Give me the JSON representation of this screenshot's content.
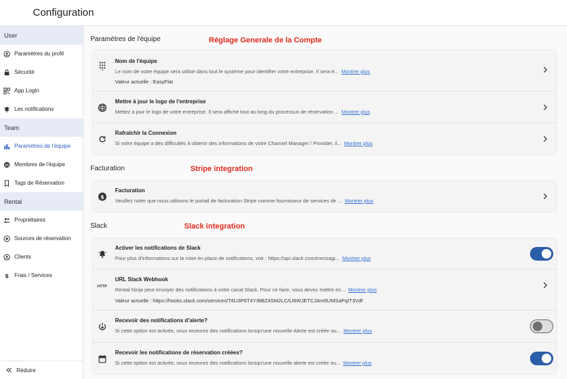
{
  "header": {
    "title": "Configuration"
  },
  "sidebar": {
    "sections": [
      {
        "label": "User",
        "items": [
          {
            "label": "Paramètres du profil",
            "icon": "account-circle-icon"
          },
          {
            "label": "Sécurité",
            "icon": "lock-icon"
          },
          {
            "label": "App Login",
            "icon": "qr-code-icon"
          },
          {
            "label": "Les notifications",
            "icon": "notification-bell-icon"
          }
        ]
      },
      {
        "label": "Team",
        "items": [
          {
            "label": "Paramètres de l'équipe",
            "icon": "bar-chart-icon",
            "active": true
          },
          {
            "label": "Membres de l'équipe",
            "icon": "team-circle-icon"
          },
          {
            "label": "Tags de Réservation",
            "icon": "bookmark-icon"
          }
        ]
      },
      {
        "label": "Rental",
        "items": [
          {
            "label": "Propriétaires",
            "icon": "people-icon"
          },
          {
            "label": "Sources de réservation",
            "icon": "source-icon"
          },
          {
            "label": "Clients",
            "icon": "client-icon"
          },
          {
            "label": "Frais / Services",
            "icon": "dollar-icon"
          }
        ]
      }
    ],
    "footer": {
      "label": "Réduire",
      "icon": "double-chevron-left-icon"
    }
  },
  "main": {
    "more_label": "Montrer plus",
    "team": {
      "title": "Paramètres de l'équipe",
      "annotation": "Réglage Generale de la Compte",
      "rows": [
        {
          "title": "Nom de l'équipe",
          "icon": "dialpad-icon",
          "desc": "Le nom de votre équipe sera utilisé dans tout le système pour identifier votre entreprise. Il sera é...",
          "value": "Valeur actuelle : EasyFlat"
        },
        {
          "title": "Mettre à jour le logo de l'entreprise",
          "icon": "globe-icon",
          "desc": "Mettez à jour le logo de votre entreprise. Il sera affiché tout au long du processus de réservation ..."
        },
        {
          "title": "Rafraîchir la Connexion",
          "icon": "refresh-icon",
          "desc": "Si votre équipe a des difficultés à obtenir des informations de votre Channel Manager / Provider, il..."
        }
      ]
    },
    "billing": {
      "title": "Facturation",
      "annotation": "Stripe integration",
      "rows": [
        {
          "title": "Facturation",
          "icon": "dollar-circle-icon",
          "desc": "Veuillez noter que nous utilisons le portail de facturation Stripe comme fournisseur de services de ..."
        }
      ]
    },
    "slack": {
      "title": "Slack",
      "annotation": "Slack integration",
      "rows": [
        {
          "title": "Activer les notifications de Slack",
          "icon": "notification-active-icon",
          "desc": "Pour plus d'informations sur la mise en place de notifications, voir : https://api.slack.com/messagi...",
          "toggle": true
        },
        {
          "title": "URL Slack Webhook",
          "icon": "http-icon",
          "icon_text": "HTTP",
          "desc": "Rental Ninja peut envoyer des notifications à votre canal Slack. Pour ce faire, vous devez mettre en...",
          "value": "Valeur actuelle : https://hooks.slack.com/services/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"
        },
        {
          "title": "Recevoir des notifications d'alerte?",
          "icon": "alert-power-icon",
          "desc": "Si cette option est activée, vous recevrez des notifications lorsqu'une nouvelle Alerte est créée ou...",
          "toggle": false
        },
        {
          "title": "Recevoir les notifications de réservation créées?",
          "icon": "calendar-icon",
          "desc": "Si cette option est activée, vous recevrez des notifications lorsqu'une nouvelle alerte est créée ou...",
          "toggle": true
        }
      ]
    }
  },
  "colors": {
    "accent": "#2b5ea8",
    "annotation": "#e02a1c",
    "sidebar_section_bg": "#e6ebf7",
    "link": "#2f6fd6"
  }
}
